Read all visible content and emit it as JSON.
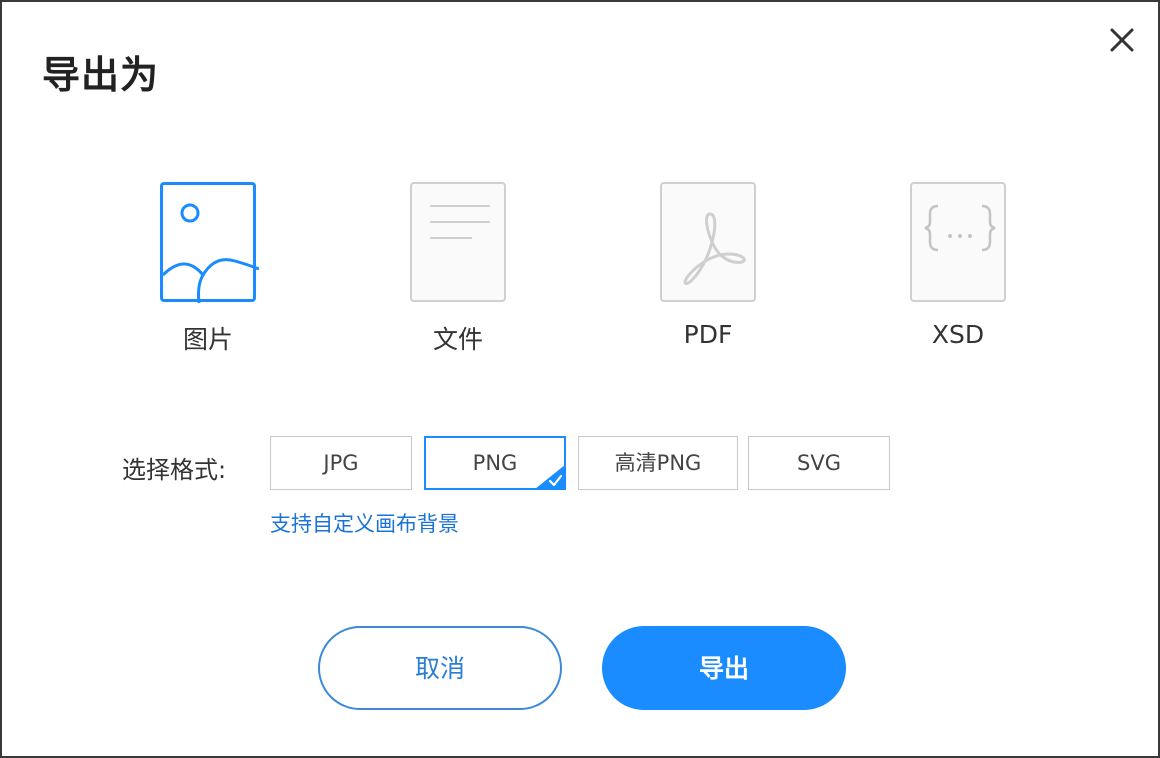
{
  "dialog": {
    "title": "导出为"
  },
  "export_types": [
    {
      "label": "图片",
      "icon": "image-icon",
      "selected": true
    },
    {
      "label": "文件",
      "icon": "document-icon",
      "selected": false
    },
    {
      "label": "PDF",
      "icon": "pdf-icon",
      "selected": false
    },
    {
      "label": "XSD",
      "icon": "code-braces-icon",
      "selected": false
    }
  ],
  "format": {
    "label": "选择格式:",
    "options": [
      {
        "label": "JPG",
        "selected": false
      },
      {
        "label": "PNG",
        "selected": true
      },
      {
        "label": "高清PNG",
        "selected": false
      },
      {
        "label": "SVG",
        "selected": false
      }
    ],
    "hint": "支持自定义画布背景"
  },
  "buttons": {
    "cancel": "取消",
    "export": "导出"
  },
  "colors": {
    "accent": "#1a8cff",
    "link": "#1a73d6",
    "border": "#c9c9c9",
    "icon_gray": "#cfcfcf"
  }
}
